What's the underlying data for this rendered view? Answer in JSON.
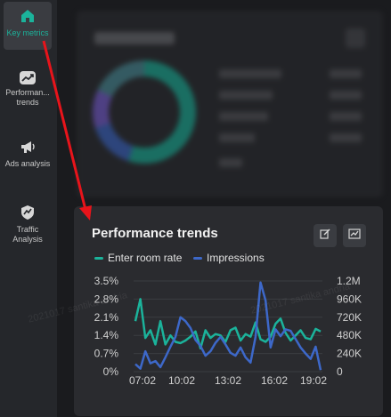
{
  "sidebar": {
    "items": [
      {
        "label": "Key metrics",
        "icon": "home-icon",
        "active": true
      },
      {
        "label": "Performan... trends",
        "icon": "trend-chart-icon",
        "active": false
      },
      {
        "label": "Ads analysis",
        "icon": "megaphone-icon",
        "active": false
      },
      {
        "label": "Traffic Analysis",
        "icon": "traffic-shield-icon",
        "active": false
      }
    ]
  },
  "card": {
    "title": "Performance trends",
    "edit_icon": "edit-icon",
    "chart_icon": "line-chart-icon"
  },
  "colors": {
    "teal": "#1bb39b",
    "blue": "#3d68c9",
    "arrow": "#e8141b"
  },
  "watermark": "2021017 santika andria",
  "chart_data": {
    "type": "line",
    "x": [
      "07:02",
      "10:02",
      "13:02",
      "16:02",
      "19:02"
    ],
    "left_axis": {
      "ticks": [
        "3.5%",
        "2.8%",
        "2.1%",
        "1.4%",
        "0.7%",
        "0%"
      ],
      "range": [
        0,
        3.5
      ]
    },
    "right_axis": {
      "ticks": [
        "1.2M",
        "960K",
        "720K",
        "480K",
        "240K",
        "0"
      ],
      "range": [
        0,
        1200000
      ]
    },
    "series": [
      {
        "name": "Enter room rate",
        "axis": "left",
        "color": "#1bb39b",
        "values": [
          1.95,
          2.8,
          1.3,
          1.6,
          1.05,
          1.95,
          1.05,
          1.4,
          1.15,
          1.1,
          1.2,
          1.35,
          1.55,
          0.9,
          1.6,
          1.3,
          1.45,
          1.4,
          1.15,
          1.6,
          1.7,
          1.2,
          1.45,
          1.35,
          1.9,
          1.25,
          1.15,
          1.35,
          1.85,
          2.05,
          1.5,
          1.2,
          1.4,
          1.6,
          1.3,
          1.25,
          1.65,
          1.55
        ]
      },
      {
        "name": "Impressions",
        "axis": "right",
        "color": "#3d68c9",
        "values": [
          100000,
          40000,
          270000,
          110000,
          140000,
          60000,
          190000,
          330000,
          460000,
          720000,
          670000,
          580000,
          420000,
          340000,
          210000,
          270000,
          380000,
          460000,
          360000,
          250000,
          210000,
          320000,
          190000,
          120000,
          460000,
          1180000,
          940000,
          320000,
          560000,
          470000,
          560000,
          540000,
          430000,
          320000,
          240000,
          170000,
          330000,
          20000
        ]
      }
    ]
  }
}
